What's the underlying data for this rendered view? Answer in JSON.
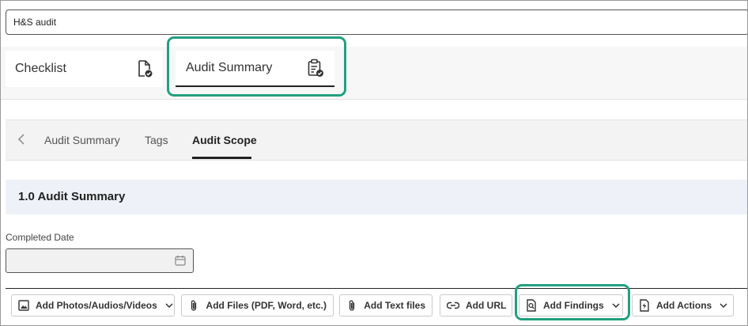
{
  "form": {
    "title_value": "H&S audit"
  },
  "main_tabs": [
    {
      "label": "Checklist"
    },
    {
      "label": "Audit Summary"
    }
  ],
  "sub_tabs": [
    {
      "label": "Audit Summary"
    },
    {
      "label": "Tags"
    },
    {
      "label": "Audit Scope"
    }
  ],
  "active_sub_tab": "Audit Scope",
  "section": {
    "title": "1.0 Audit Summary"
  },
  "fields": {
    "completed_date": {
      "label": "Completed Date",
      "value": ""
    }
  },
  "toolbar": {
    "buttons": [
      {
        "label": "Add Photos/Audios/Videos",
        "icon": "image-icon",
        "dropdown": true
      },
      {
        "label": "Add Files (PDF, Word, etc.)",
        "icon": "paperclip-icon",
        "dropdown": false
      },
      {
        "label": "Add Text files",
        "icon": "paperclip-icon",
        "dropdown": false
      },
      {
        "label": "Add URL",
        "icon": "link-icon",
        "dropdown": false
      },
      {
        "label": "Add Findings",
        "icon": "findings-icon",
        "dropdown": true
      },
      {
        "label": "Add Actions",
        "icon": "actions-icon",
        "dropdown": true
      }
    ]
  },
  "colors": {
    "highlight": "#23a07f",
    "section_bg": "#eef2f8",
    "band_bg": "#f7f7f7"
  }
}
